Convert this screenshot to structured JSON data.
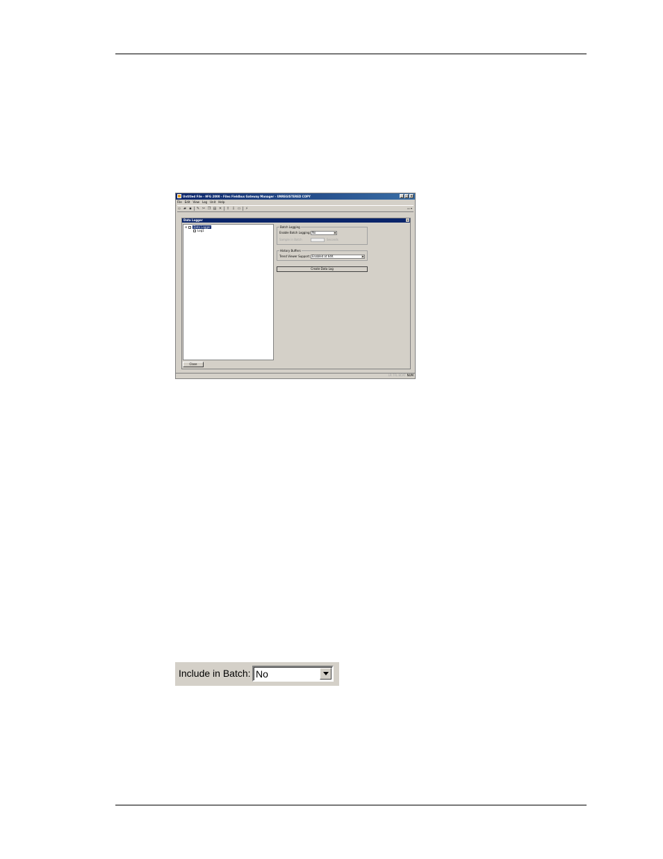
{
  "app": {
    "title": "Untitled File - 9FG 2000 - Files Fieldbus Gateway Manager - UNREGISTERED COPY",
    "menu": [
      "File",
      "Edit",
      "View",
      "Log",
      "Unit",
      "Help"
    ],
    "toolbar_right": "▭ ▾"
  },
  "data_logger": {
    "window_title": "Data Logger",
    "tree": [
      {
        "label": "Data Logger",
        "selected": true
      },
      {
        "label": "Log1",
        "selected": false
      }
    ],
    "close_button": "Close",
    "batch_group": {
      "label": "Batch Logging",
      "enable_label": "Enable Batch Logging:",
      "enable_value": "No",
      "sample_label": "Sample in Batch",
      "seconds_label": "Seconds"
    },
    "history_group": {
      "label": "History Buffers",
      "trend_label": "Trend Viewer Support:",
      "trend_value": "Enabled at 64K"
    },
    "create_button": "Create Data Log"
  },
  "statusbar": {
    "left": "",
    "dim": "LR 7FL 8CAT",
    "num": "NUM"
  },
  "zoom_control": {
    "label": "Include in Batch:",
    "value": "No"
  }
}
